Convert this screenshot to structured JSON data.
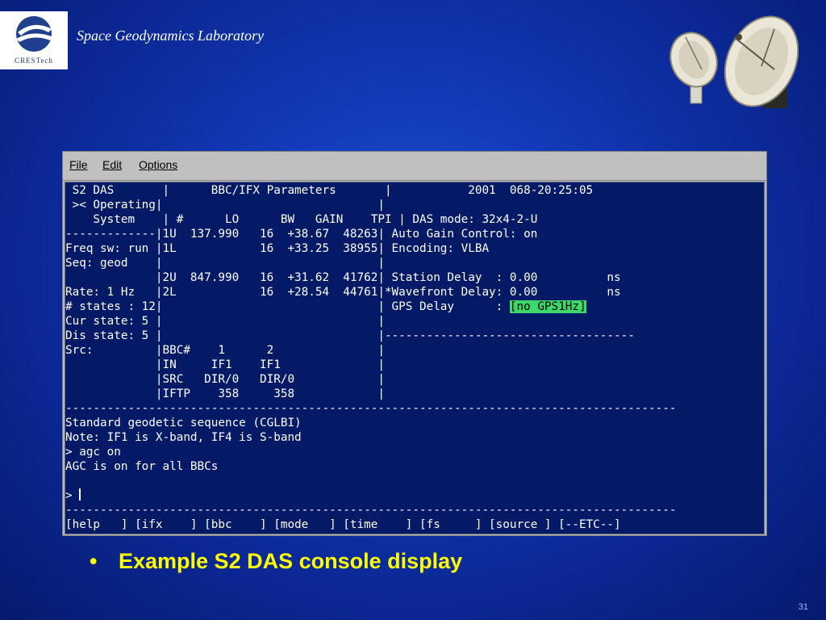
{
  "header": {
    "logo_text": "CRESTech",
    "lab_title": "Space Geodynamics Laboratory"
  },
  "menu": {
    "file": "File",
    "edit": "Edit",
    "options": "Options"
  },
  "terminal": {
    "lines": [
      " S2 DAS       |      BBC/IFX Parameters       |           2001  068-20:25:05",
      " >< Operating|                               |",
      "    System    | #      LO      BW   GAIN    TPI | DAS mode: 32x4-2-U",
      "-------------|1U  137.990   16  +38.67  48263| Auto Gain Control: on",
      "Freq sw: run |1L            16  +33.25  38955| Encoding: VLBA",
      "Seq: geod    |                               |",
      "             |2U  847.990   16  +31.62  41762| Station Delay  : 0.00          ns",
      "Rate: 1 Hz   |2L            16  +28.54  44761|*Wavefront Delay: 0.00          ns",
      "# states : 12|                               | GPS Delay      : ",
      "Cur state: 5 |                               |",
      "Dis state: 5 |                               |------------------------------------",
      "Src:         |BBC#    1      2               |",
      "             |IN     IF1    IF1              |",
      "             |SRC   DIR/0   DIR/0            |",
      "             |IFTP    358     358            |",
      "----------------------------------------------------------------------------------------",
      "Standard geodetic sequence (CGLBI)",
      "Note: IF1 is X-band, IF4 is S-band",
      "> agc on",
      "AGC is on for all BBCs",
      "",
      "> ",
      "----------------------------------------------------------------------------------------",
      "[help   ] [ifx    ] [bbc    ] [mode   ] [time    ] [fs     ] [source ] [--ETC--]"
    ],
    "gps_highlight": "[no GPS1Hz]"
  },
  "bullet": {
    "text": "Example S2 DAS console display"
  },
  "page_number": "31",
  "colors": {
    "terminal_bg": "#041a66",
    "highlight": "#3cd86a",
    "bullet_text": "#ffff00"
  }
}
